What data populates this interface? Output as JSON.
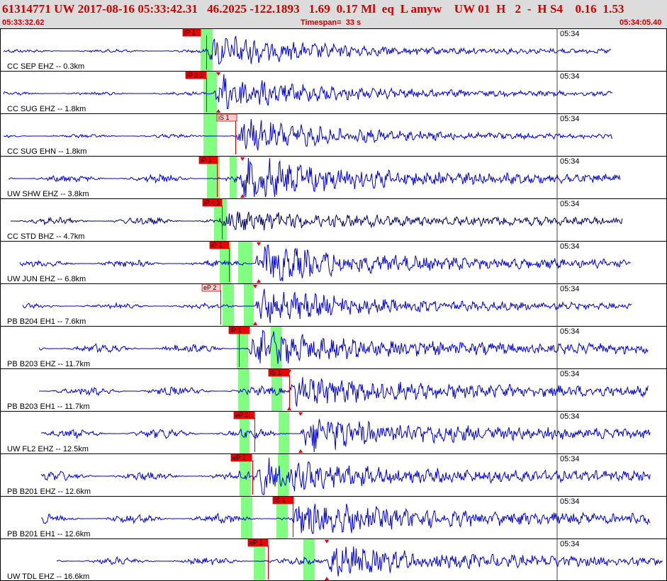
{
  "header": {
    "title": "61314771 UW 2017-08-16 05:33:42.31   46.2025 -122.1893   1.69  0.17 Ml  eq  L amyw    UW 01  H   2  -  H S4    0.16  1.53",
    "start_time": "05:33:32.62",
    "timespan_label": "Timespan=",
    "timespan_value": "33 s",
    "end_time": "05:34:05.40"
  },
  "colors": {
    "trace": "#0000cc",
    "trace_alt": "#000066",
    "pick_box": "#ee0000",
    "pick_box_light": "#ffcccc",
    "window": "#80ff80",
    "header_bg": "#dcdcdc",
    "header_text": "#cc0000"
  },
  "tick_label": "05:34",
  "channels": [
    {
      "label": "CC SEP EHZ -- 0.3km",
      "picks": [
        {
          "text": "iP 1"
        }
      ]
    },
    {
      "label": "CC SUG EHZ -- 1.8km",
      "picks": [
        {
          "text": "iP c 1"
        }
      ]
    },
    {
      "label": "CC SUG EHN -- 1.8km",
      "picks": [
        {
          "text": "iS 1"
        }
      ]
    },
    {
      "label": "UW SHW EHZ -- 3.8km",
      "picks": [
        {
          "text": "iP 1"
        }
      ]
    },
    {
      "label": "CC STD BHZ -- 4.7km",
      "picks": [
        {
          "text": "iP c 1"
        }
      ]
    },
    {
      "label": "UW JUN EHZ -- 6.8km",
      "picks": [
        {
          "text": "iP 1"
        }
      ]
    },
    {
      "label": "PB B204 EH1 -- 7.6km",
      "picks": [
        {
          "text": "eP 2"
        }
      ]
    },
    {
      "label": "PB B203 EHZ -- 11.7km",
      "picks": [
        {
          "text": "iP 1"
        }
      ]
    },
    {
      "label": "PB B203 EH1 -- 11.7km",
      "picks": [
        {
          "text": "iS 1"
        }
      ]
    },
    {
      "label": "UW FL2 EHZ -- 12.5km",
      "picks": [
        {
          "text": "eP 2"
        }
      ]
    },
    {
      "label": "PB B201 EHZ -- 12.6km",
      "picks": [
        {
          "text": "eP 2"
        }
      ]
    },
    {
      "label": "PB B201 EH1 -- 12.6km",
      "picks": [
        {
          "text": "iS 1"
        }
      ]
    },
    {
      "label": "UW TDL EHZ -- 16.6km",
      "picks": [
        {
          "text": "eP 2"
        }
      ]
    }
  ]
}
